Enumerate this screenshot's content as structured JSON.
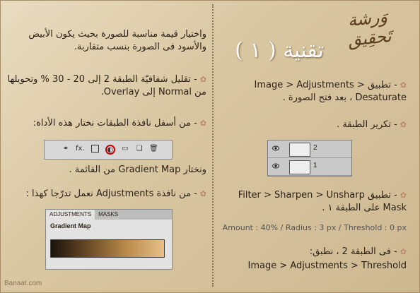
{
  "header": {
    "logo": "وَرشة تَحقِيق",
    "title": "تقنية ( ١ )"
  },
  "right": {
    "step1": "- تطبيق Image > Adjustments > Desaturate ، بعد فتح الصورة .",
    "step2": "- تكرير الطبقة .",
    "step3a": "- تطبيق Filter > Sharpen > Unsharp Mask على الطبقة ١ .",
    "step3b": "Amount : 40% / Radius : 3 px / Threshold : 0 px",
    "step4a": "- فى الطبقة 2 ، نطبق:",
    "step4b": "Image > Adjustments > Threshold"
  },
  "left": {
    "intro": "واختيار قيمة مناسبة للصورة بحيث يكون الأبيض والأسود فى الصورة بنسب متقاربة.",
    "step5": "- تقليل شفافيّة الطبقة 2 إلى 20 - 30 % وتحويلها من Normal إلى Overlay.",
    "step6": "- من أسفل نافذة الطبقات نختار هذه الأداة:",
    "step6b": "ونختار Gradient Map من القائمة .",
    "step7": "- من نافذة Adjustments نعمل تدرّجا كهذا :"
  },
  "layers": [
    {
      "name": "2"
    },
    {
      "name": "1"
    }
  ],
  "adjust": {
    "tab1": "ADJUSTMENTS",
    "tab2": "MASKS",
    "panel": "Gradient Map"
  },
  "toolbar": {
    "fx": "fx."
  },
  "watermark": "Banaat.com"
}
